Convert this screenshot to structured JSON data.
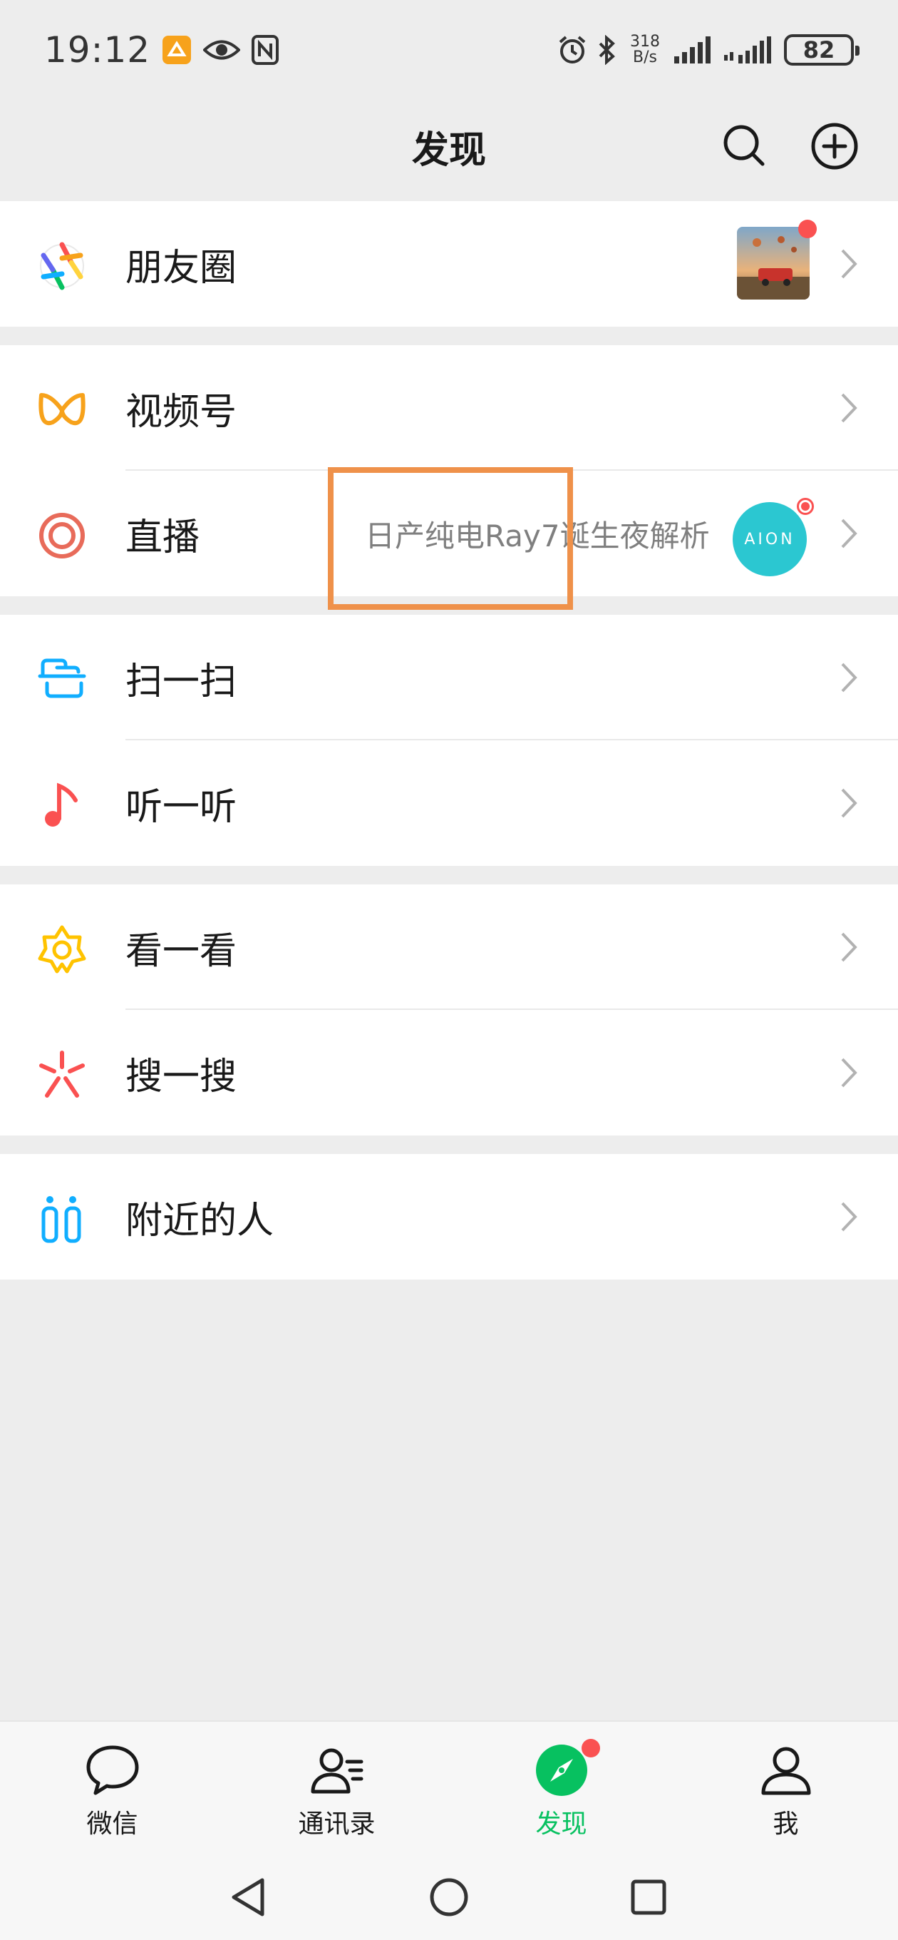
{
  "status": {
    "time": "19:12",
    "speed_value": "318",
    "speed_unit": "B/s",
    "battery": "82"
  },
  "header": {
    "title": "发现",
    "search_icon": "search-icon",
    "add_icon": "plus-circle-icon"
  },
  "groups": [
    {
      "items": [
        {
          "label": "朋友圈",
          "icon": "moments-aperture-icon",
          "has_thumbnail": true,
          "has_red_dot": true
        }
      ]
    },
    {
      "items": [
        {
          "label": "视频号",
          "icon": "channels-icon"
        },
        {
          "label": "直播",
          "icon": "live-icon",
          "subtitle": "日产纯电Ray7诞生夜解析",
          "avatar_text": "AION"
        }
      ]
    },
    {
      "items": [
        {
          "label": "扫一扫",
          "icon": "scan-icon"
        },
        {
          "label": "听一听",
          "icon": "music-note-icon"
        }
      ]
    },
    {
      "items": [
        {
          "label": "看一看",
          "icon": "top-stories-icon"
        },
        {
          "label": "搜一搜",
          "icon": "search-star-icon"
        }
      ]
    },
    {
      "items": [
        {
          "label": "附近的人",
          "icon": "people-nearby-icon"
        }
      ]
    }
  ],
  "tabs": [
    {
      "label": "微信",
      "icon": "chat-bubble-icon",
      "active": false
    },
    {
      "label": "通讯录",
      "icon": "contacts-icon",
      "active": false
    },
    {
      "label": "发现",
      "icon": "compass-icon",
      "active": true,
      "has_red_dot": true
    },
    {
      "label": "我",
      "icon": "person-icon",
      "active": false
    }
  ],
  "colors": {
    "accent": "#07c160",
    "badge": "#fa5151",
    "highlight": "#ef914a",
    "background": "#ededed"
  }
}
